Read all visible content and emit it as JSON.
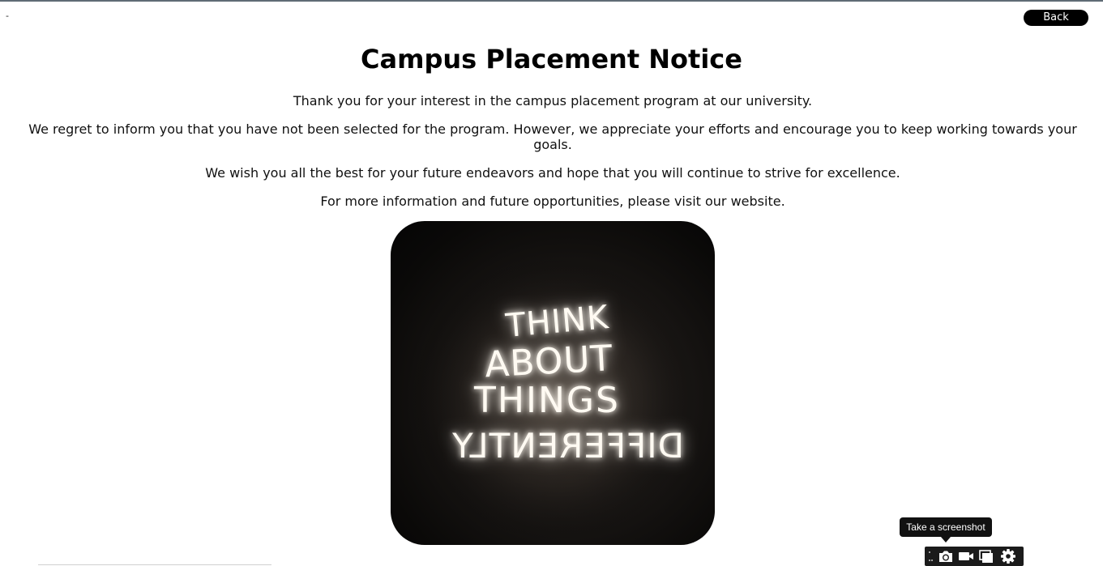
{
  "page": {
    "corner_mark": "-",
    "back_label": "Back",
    "title": "Campus Placement Notice",
    "paragraphs": [
      "Thank you for your interest in the campus placement program at our university.",
      "We regret to inform you that you have not been selected for the program. However, we appreciate your efforts and encourage you to keep working towards your goals.",
      "We wish you all the best for your future endeavors and hope that you will continue to strive for excellence.",
      "For more information and future opportunities, please visit our website."
    ]
  },
  "image": {
    "neon_lines": [
      "THINK",
      "ABOUT",
      "THINGS",
      "DIFFERENTLY"
    ]
  },
  "toolbar": {
    "tooltip": "Take a screenshot",
    "icons": [
      "grip-icon",
      "camera-icon",
      "video-camera-icon",
      "window-copy-icon",
      "gear-icon"
    ]
  },
  "colors": {
    "button_bg": "#000000",
    "toolbar_bg": "#1b1b1b",
    "neon_glow": "#fff8ee"
  }
}
